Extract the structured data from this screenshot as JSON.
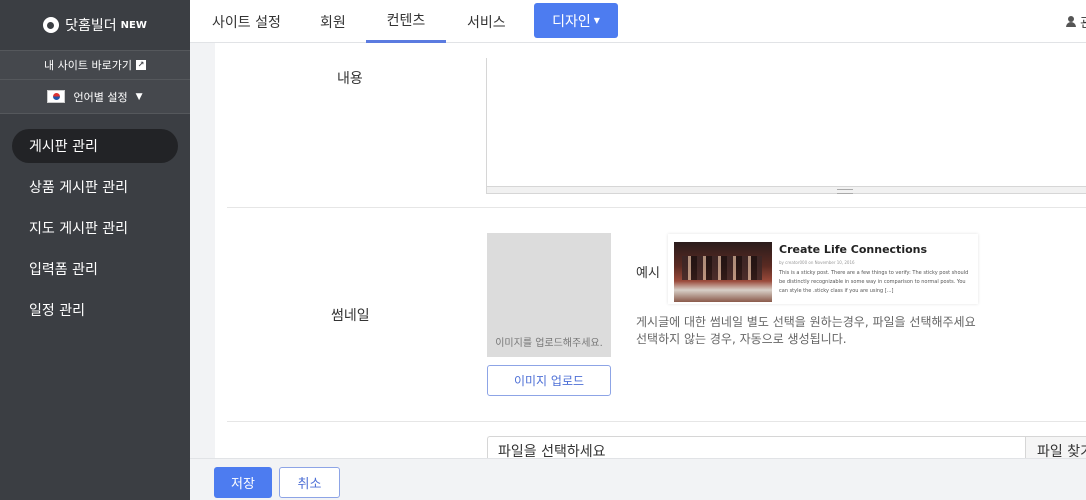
{
  "sidebar": {
    "logo_text": "닷홈빌더",
    "logo_badge": "NEW",
    "site_link": "내 사이트 바로가기",
    "language_label": "언어별 설정",
    "menu": [
      {
        "label": "게시판 관리",
        "active": true
      },
      {
        "label": "상품 게시판 관리",
        "active": false
      },
      {
        "label": "지도 게시판 관리",
        "active": false
      },
      {
        "label": "입력폼 관리",
        "active": false
      },
      {
        "label": "일정 관리",
        "active": false
      }
    ]
  },
  "topbar": {
    "tabs": [
      "사이트 설정",
      "회원",
      "컨텐츠",
      "서비스"
    ],
    "active_tab": "컨텐츠",
    "design_button": "디자인",
    "user_label": "관"
  },
  "form": {
    "content_label": "내용",
    "thumbnail_label": "썸네일",
    "thumbnail_placeholder": "이미지를 업로드해주세요.",
    "upload_button": "이미지 업로드",
    "example_label": "예시",
    "example_card": {
      "title": "Create Life Connections",
      "meta": "by creator000 on November 10, 2016",
      "text": "This is a sticky post. There are a few things to verify: The sticky post should be distinctly recognizable in some way in comparison to normal posts. You can style the .sticky class if you are using [...]"
    },
    "description_line1": "게시글에 대한 썸네일 별도 선택을 원하는경우, 파일을 선택해주세요",
    "description_line2": "선택하지 않는 경우, 자동으로 생성됩니다.",
    "file_placeholder": "파일을 선택하세요",
    "file_button": "파일 찾기"
  },
  "footer": {
    "save": "저장",
    "cancel": "취소"
  },
  "colors": {
    "sidebar_bg": "#3b3e43",
    "accent": "#4d7cf0"
  }
}
